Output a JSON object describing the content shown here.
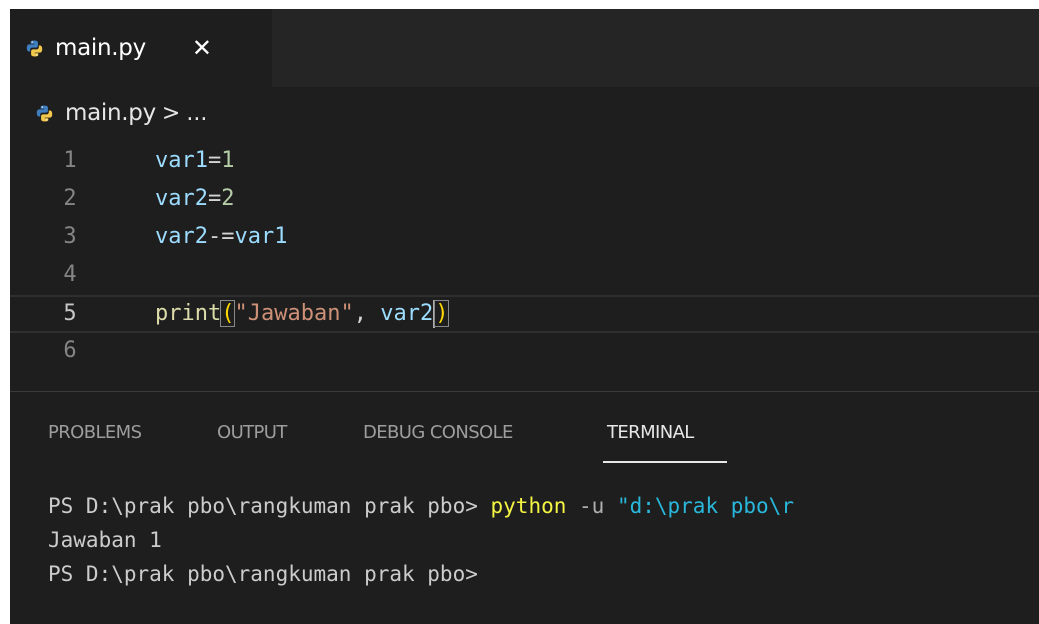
{
  "tab": {
    "filename": "main.py",
    "close_glyph": "✕"
  },
  "breadcrumb": {
    "file": "main.py",
    "separator": ">",
    "more": "..."
  },
  "editor": {
    "lines": [
      {
        "number": "1",
        "tokens": [
          {
            "t": "var1",
            "c": "var"
          },
          {
            "t": "=",
            "c": "op"
          },
          {
            "t": "1",
            "c": "num"
          }
        ]
      },
      {
        "number": "2",
        "tokens": [
          {
            "t": "var2",
            "c": "var"
          },
          {
            "t": "=",
            "c": "op"
          },
          {
            "t": "2",
            "c": "num"
          }
        ]
      },
      {
        "number": "3",
        "tokens": [
          {
            "t": "var2",
            "c": "var"
          },
          {
            "t": "-=",
            "c": "op"
          },
          {
            "t": "var1",
            "c": "var"
          }
        ]
      },
      {
        "number": "4",
        "tokens": []
      },
      {
        "number": "5",
        "tokens": [
          {
            "t": "print",
            "c": "fn"
          },
          {
            "t": "(",
            "c": "paren"
          },
          {
            "t": "\"Jawaban\"",
            "c": "str"
          },
          {
            "t": ", ",
            "c": "op"
          },
          {
            "t": "var2",
            "c": "var"
          },
          {
            "t": ")",
            "c": "paren"
          }
        ]
      },
      {
        "number": "6",
        "tokens": []
      }
    ],
    "current_line": 5
  },
  "panel": {
    "tabs": [
      {
        "label": "PROBLEMS",
        "active": false
      },
      {
        "label": "OUTPUT",
        "active": false
      },
      {
        "label": "DEBUG CONSOLE",
        "active": false
      },
      {
        "label": "TERMINAL",
        "active": true
      }
    ]
  },
  "terminal": {
    "prompt1": "PS D:\\prak pbo\\rangkuman prak pbo> ",
    "command": "python",
    "flag": " -u ",
    "arg": "\"d:\\prak pbo\\r",
    "output": "Jawaban 1",
    "prompt2": "PS D:\\prak pbo\\rangkuman prak pbo>"
  },
  "colors": {
    "editor_bg": "#1e1e1e",
    "tabbar_bg": "#252526",
    "variable": "#9cdcfe",
    "number": "#b5cea8",
    "function": "#dcdcaa",
    "string": "#ce9178",
    "bracket": "#ffd700",
    "terminal_command": "#f5f543",
    "terminal_string": "#29b8db"
  },
  "icons": {
    "file_icon": "python-icon"
  }
}
